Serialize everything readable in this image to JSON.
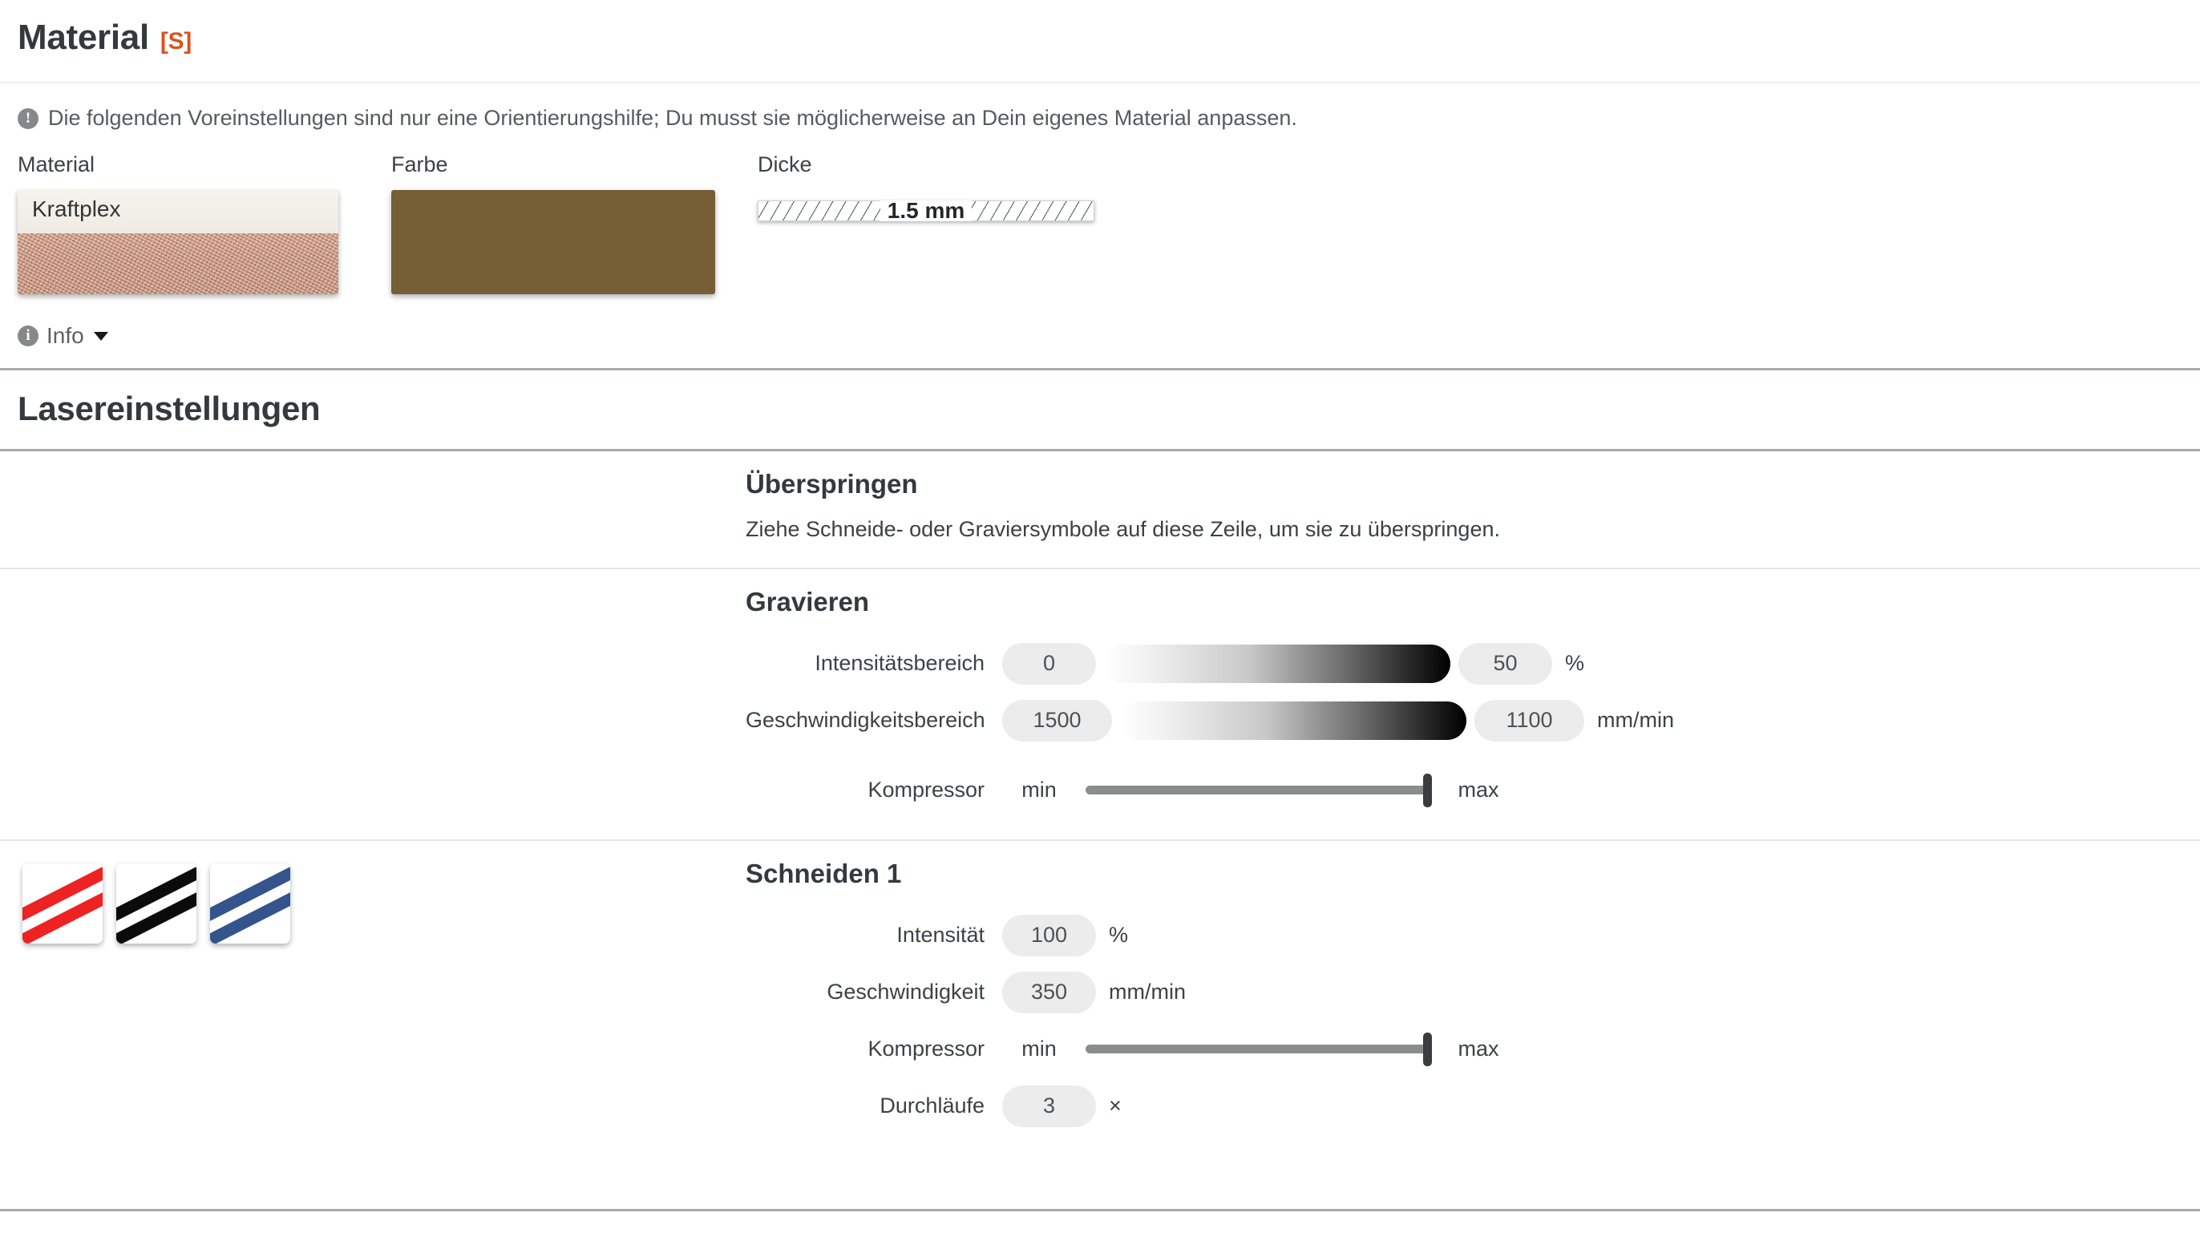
{
  "material_section": {
    "title": "Material",
    "title_badge": "[S]",
    "notice": "Die folgenden Voreinstellungen sind nur eine Orientierungshilfe; Du musst sie möglicherweise an Dein eigenes Material anpassen.",
    "notice_icon": "exclamation-circle-icon",
    "material_picker": {
      "label": "Material",
      "value": "Kraftplex"
    },
    "color_picker": {
      "label": "Farbe",
      "value_hex": "#765F37"
    },
    "thickness_picker": {
      "label": "Dicke",
      "value": "1.5 mm"
    },
    "info_toggle": {
      "label": "Info",
      "icon": "info-circle-icon",
      "caret": "chevron-down-icon"
    }
  },
  "laser_section": {
    "title": "Lasereinstellungen",
    "operations": [
      {
        "name": "skip",
        "title": "Überspringen",
        "description": "Ziehe Schneide- oder Graviersymbole auf diese Zeile, um sie zu überspringen."
      },
      {
        "name": "engrave",
        "title": "Gravieren",
        "params": {
          "intensity_range": {
            "label": "Intensitätsbereich",
            "from": "0",
            "to": "50",
            "unit": "%"
          },
          "speed_range": {
            "label": "Geschwindigkeitsbereich",
            "from": "1500",
            "to": "1100",
            "unit": "mm/min"
          },
          "compressor": {
            "label": "Kompressor",
            "min_label": "min",
            "max_label": "max",
            "value_percent": 100
          }
        }
      },
      {
        "name": "cut-1",
        "title": "Schneiden 1",
        "icons": [
          {
            "name": "cut-symbol-red",
            "color": "#EE2222"
          },
          {
            "name": "cut-symbol-black",
            "color": "#0B0B0B"
          },
          {
            "name": "cut-symbol-blue",
            "color": "#33548C"
          }
        ],
        "params": {
          "intensity": {
            "label": "Intensität",
            "value": "100",
            "unit": "%"
          },
          "speed": {
            "label": "Geschwindigkeit",
            "value": "350",
            "unit": "mm/min"
          },
          "compressor": {
            "label": "Kompressor",
            "min_label": "min",
            "max_label": "max",
            "value_percent": 100
          },
          "passes": {
            "label": "Durchläufe",
            "value": "3",
            "unit": "×"
          }
        }
      }
    ]
  }
}
